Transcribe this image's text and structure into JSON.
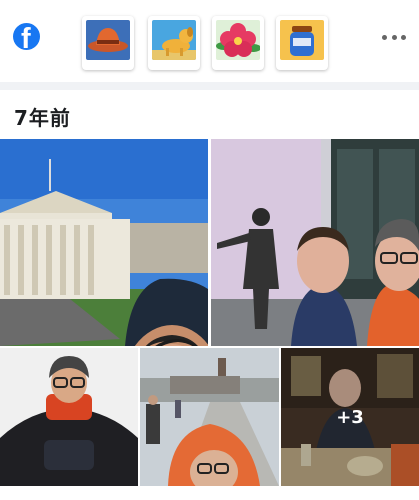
{
  "app": {
    "logo_glyph": "f",
    "brand_color": "#1877f2"
  },
  "memories": {
    "stickers": [
      "hat-sticker",
      "dog-sticker",
      "flower-sticker",
      "jar-sticker"
    ],
    "more_icon": "more-horizontal-icon"
  },
  "section": {
    "title": "7年前"
  },
  "photos": {
    "items": [
      "museum-selfie",
      "statue-selfie",
      "backpack-selfie",
      "bridge-selfie",
      "pub-photo"
    ],
    "more_count_label": "+3"
  }
}
